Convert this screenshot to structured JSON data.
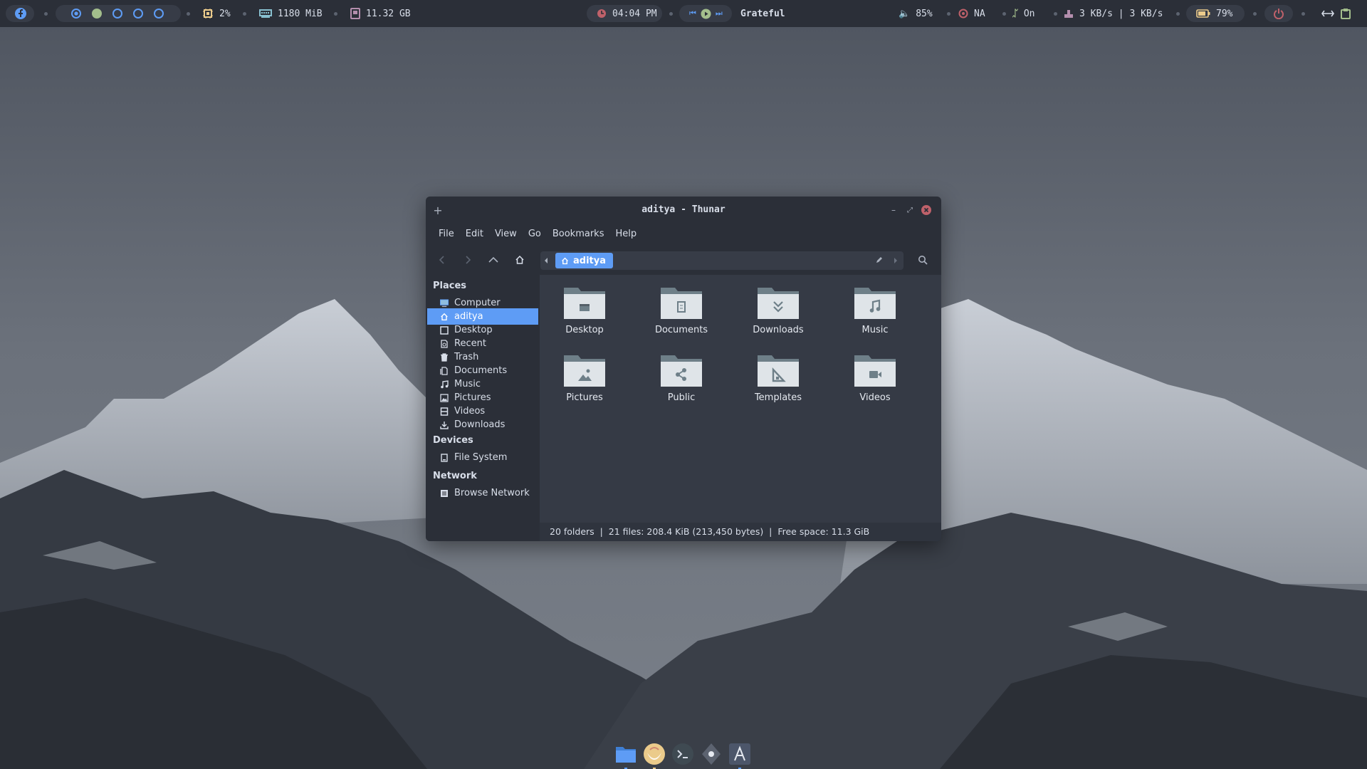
{
  "topbar": {
    "cpu": "2%",
    "memory": "1180 MiB",
    "disk": "11.32 GB",
    "clock": "04:04 PM",
    "song": "Grateful",
    "volume": "85%",
    "network_status": "NA",
    "bluetooth": "On",
    "net_speed": "3 KB/s | 3 KB/s",
    "battery": "79%",
    "accent": "#5e9cf5"
  },
  "window": {
    "title": "aditya - Thunar",
    "menu": [
      "File",
      "Edit",
      "View",
      "Go",
      "Bookmarks",
      "Help"
    ],
    "path": "aditya"
  },
  "sidebar": {
    "places_heading": "Places",
    "places": [
      {
        "label": "Computer",
        "icon": "computer-icon"
      },
      {
        "label": "aditya",
        "icon": "home-icon",
        "selected": true
      },
      {
        "label": "Desktop",
        "icon": "desktop-icon"
      },
      {
        "label": "Recent",
        "icon": "recent-icon"
      },
      {
        "label": "Trash",
        "icon": "trash-icon"
      },
      {
        "label": "Documents",
        "icon": "documents-icon"
      },
      {
        "label": "Music",
        "icon": "music-icon"
      },
      {
        "label": "Pictures",
        "icon": "pictures-icon"
      },
      {
        "label": "Videos",
        "icon": "videos-icon"
      },
      {
        "label": "Downloads",
        "icon": "downloads-icon"
      }
    ],
    "devices_heading": "Devices",
    "devices": [
      {
        "label": "File System",
        "icon": "drive-icon"
      }
    ],
    "network_heading": "Network",
    "network": [
      {
        "label": "Browse Network",
        "icon": "network-icon"
      }
    ]
  },
  "folders": [
    {
      "label": "Desktop",
      "icon": "desktop-folder-icon"
    },
    {
      "label": "Documents",
      "icon": "documents-folder-icon"
    },
    {
      "label": "Downloads",
      "icon": "downloads-folder-icon"
    },
    {
      "label": "Music",
      "icon": "music-folder-icon"
    },
    {
      "label": "Pictures",
      "icon": "pictures-folder-icon"
    },
    {
      "label": "Public",
      "icon": "public-folder-icon"
    },
    {
      "label": "Templates",
      "icon": "templates-folder-icon"
    },
    {
      "label": "Videos",
      "icon": "videos-folder-icon"
    }
  ],
  "status": "20 folders  |  21 files: 208.4 KiB (213,450 bytes)  |  Free space: 11.3 GiB",
  "dock": [
    "file-manager-icon",
    "firefox-icon",
    "terminal-icon",
    "settings-icon",
    "text-editor-icon"
  ]
}
